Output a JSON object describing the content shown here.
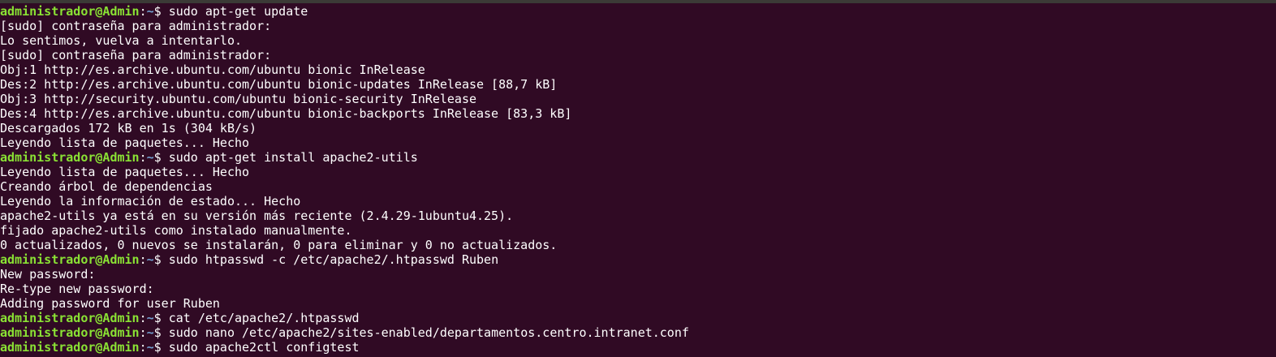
{
  "terminal": {
    "colors": {
      "background": "#300a24",
      "text": "#ffffff",
      "prompt_user": "#8ae234",
      "prompt_path": "#729fcf"
    },
    "lines": [
      {
        "type": "prompt",
        "user": "administrador@Admin",
        "path": "~",
        "symbol": "$ ",
        "command": "sudo apt-get update"
      },
      {
        "type": "output",
        "text": "[sudo] contraseña para administrador:"
      },
      {
        "type": "output",
        "text": "Lo sentimos, vuelva a intentarlo."
      },
      {
        "type": "output",
        "text": "[sudo] contraseña para administrador:"
      },
      {
        "type": "output",
        "text": "Obj:1 http://es.archive.ubuntu.com/ubuntu bionic InRelease"
      },
      {
        "type": "output",
        "text": "Des:2 http://es.archive.ubuntu.com/ubuntu bionic-updates InRelease [88,7 kB]"
      },
      {
        "type": "output",
        "text": "Obj:3 http://security.ubuntu.com/ubuntu bionic-security InRelease"
      },
      {
        "type": "output",
        "text": "Des:4 http://es.archive.ubuntu.com/ubuntu bionic-backports InRelease [83,3 kB]"
      },
      {
        "type": "output",
        "text": "Descargados 172 kB en 1s (304 kB/s)"
      },
      {
        "type": "output",
        "text": "Leyendo lista de paquetes... Hecho"
      },
      {
        "type": "prompt",
        "user": "administrador@Admin",
        "path": "~",
        "symbol": "$ ",
        "command": "sudo apt-get install apache2-utils"
      },
      {
        "type": "output",
        "text": "Leyendo lista de paquetes... Hecho"
      },
      {
        "type": "output",
        "text": "Creando árbol de dependencias"
      },
      {
        "type": "output",
        "text": "Leyendo la información de estado... Hecho"
      },
      {
        "type": "output",
        "text": "apache2-utils ya está en su versión más reciente (2.4.29-1ubuntu4.25)."
      },
      {
        "type": "output",
        "text": "fijado apache2-utils como instalado manualmente."
      },
      {
        "type": "output",
        "text": "0 actualizados, 0 nuevos se instalarán, 0 para eliminar y 0 no actualizados."
      },
      {
        "type": "prompt",
        "user": "administrador@Admin",
        "path": "~",
        "symbol": "$ ",
        "command": "sudo htpasswd -c /etc/apache2/.htpasswd Ruben"
      },
      {
        "type": "output",
        "text": "New password:"
      },
      {
        "type": "output",
        "text": "Re-type new password:"
      },
      {
        "type": "output",
        "text": "Adding password for user Ruben"
      },
      {
        "type": "prompt",
        "user": "administrador@Admin",
        "path": "~",
        "symbol": "$ ",
        "command": "cat /etc/apache2/.htpasswd"
      },
      {
        "type": "prompt",
        "user": "administrador@Admin",
        "path": "~",
        "symbol": "$ ",
        "command": "sudo nano /etc/apache2/sites-enabled/departamentos.centro.intranet.conf"
      },
      {
        "type": "prompt",
        "user": "administrador@Admin",
        "path": "~",
        "symbol": "$ ",
        "command": "sudo apache2ctl configtest"
      }
    ]
  }
}
